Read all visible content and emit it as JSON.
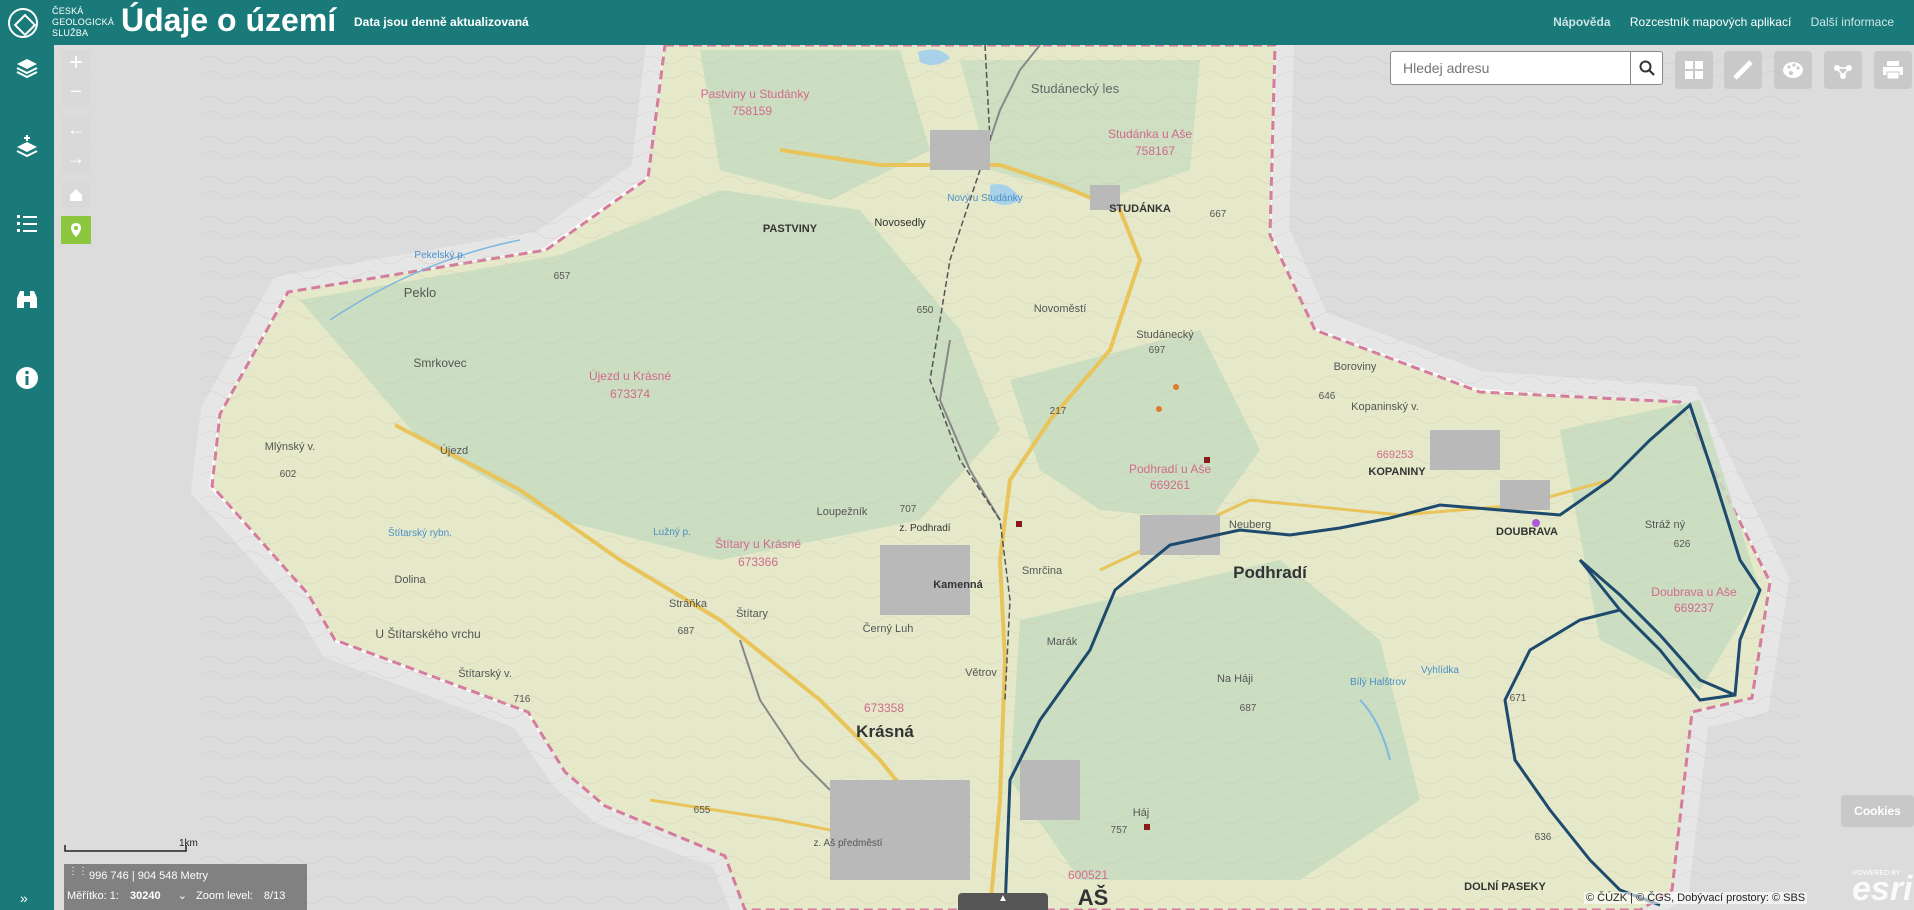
{
  "header": {
    "org_lines": [
      "ČESKÁ",
      "GEOLOGICKÁ",
      "SLUŽBA"
    ],
    "title": "Údaje o území",
    "subtitle": "Data jsou denně aktualizovaná",
    "nav": {
      "help": "Nápověda",
      "apps": "Rozcestník mapových aplikací",
      "more": "Další informace"
    }
  },
  "sidebar": {
    "items": [
      {
        "icon": "layers-icon"
      },
      {
        "icon": "layer-add-icon"
      },
      {
        "icon": "legend-list-icon"
      },
      {
        "icon": "binoculars-icon"
      },
      {
        "icon": "info-icon"
      }
    ],
    "expand_icon": "»"
  },
  "map_controls": {
    "zoom_in": "+",
    "zoom_out": "−",
    "back": "←",
    "forward": "→",
    "home_icon": "home-icon",
    "locate_icon": "locate-icon"
  },
  "search": {
    "placeholder": "Hledej adresu"
  },
  "tools": [
    "basemap-gallery-icon",
    "measure-icon",
    "palette-icon",
    "share-icon",
    "print-icon"
  ],
  "scale": {
    "bar_label": "1km",
    "coordinates": "996 746 | 904 548 Metry",
    "scale_label": "Měřítko:",
    "scale_prefix": "1:",
    "scale_value": "30240",
    "zoom_label": "Zoom level:",
    "zoom_value": "8/13"
  },
  "cookies": "Cookies",
  "attribution": "© ČÚZK | © ČGS, Dobývací prostory: © SBS",
  "esri": {
    "logo": "esri",
    "powered": "POWERED BY"
  },
  "map_labels": {
    "places": [
      "Pastviny u Studánky",
      "758159",
      "Studánka u Aše",
      "758167",
      "Studánecký les",
      "PASTVINY",
      "Novosedly",
      "Nový u Studánky",
      "STUDÁNKA",
      "Pekelský p.",
      "Peklo",
      "Smrkovec",
      "Újezd u Krásné",
      "673374",
      "Novoměstí",
      "Studánecký",
      "Boroviny",
      "Kopaninský v.",
      "669253",
      "KOPANINY",
      "Podhradí u Aše",
      "669261",
      "Mlýnský v.",
      "Újezd",
      "Neuberg",
      "DOUBRAVA",
      "Stráž ný",
      "Podhradí",
      "Štítary u Krásné",
      "673366",
      "Loupežník",
      "z. Podhradí",
      "Smrčina",
      "Kamenná",
      "Štítarský rybn.",
      "Dolina",
      "Stráňka",
      "Štítary",
      "Černý Luh",
      "Marák",
      "Doubrava u Aše",
      "669237",
      "U Štítarského vrchu",
      "Štítarský v.",
      "Větrov",
      "Na Háji",
      "Vyhlídka",
      "Bílý Halštrov",
      "673358",
      "Krásná",
      "z. Aš předměstí",
      "Háj",
      "DOLNÍ PASEKY",
      "600521",
      "AŠ",
      "Lužný p."
    ],
    "elevations": [
      "667",
      "657",
      "650",
      "697",
      "646",
      "602",
      "707",
      "626",
      "687",
      "716",
      "687",
      "671",
      "655",
      "757",
      "636",
      "217"
    ]
  },
  "bottom_tab": "▲"
}
